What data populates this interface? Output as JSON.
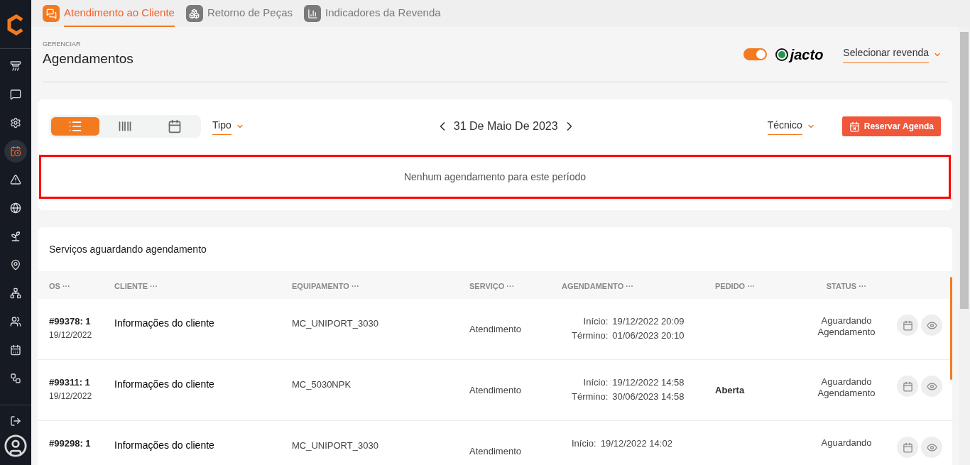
{
  "top_tabs": [
    {
      "label": "Atendimento ao Cliente",
      "selected": true
    },
    {
      "label": "Retorno de Peças",
      "selected": false
    },
    {
      "label": "Indicadores da Revenda",
      "selected": false
    }
  ],
  "sidebar": {
    "items": [
      {
        "selected": false
      },
      {
        "selected": false
      },
      {
        "selected": false
      },
      {
        "selected": true
      },
      {
        "selected": false
      },
      {
        "selected": false
      },
      {
        "selected": false
      },
      {
        "selected": false
      },
      {
        "selected": false
      },
      {
        "selected": false
      },
      {
        "selected": false
      },
      {
        "selected": false
      }
    ]
  },
  "header": {
    "overline": "GERENCIAR",
    "title": "Agendamentos",
    "toggle_on": true,
    "brand": "jacto",
    "dealer_select": "Selecionar revenda"
  },
  "toolbar": {
    "views": [
      {
        "selected": true
      },
      {
        "selected": false
      },
      {
        "selected": false
      }
    ],
    "type_select": "Tipo",
    "date": "31 De Maio De 2023",
    "tech_select": "Técnico",
    "reserve_button": "Reservar Agenda"
  },
  "empty_message": "Nenhum agendamento para este período",
  "pending": {
    "title": "Serviços aguardando agendamento",
    "columns": [
      "OS ···",
      "CLIENTE ···",
      "EQUIPAMENTO ···",
      "SERVIÇO ···",
      "AGENDAMENTO ···",
      "PEDIDO ···",
      "STATUS ···"
    ],
    "rows": [
      {
        "os": "#99378: 1",
        "date": "19/12/2022",
        "client": "Informações do cliente",
        "equipment": "MC_UNIPORT_3030",
        "service": "Atendimento",
        "start_label": "Início:",
        "start": "19/12/2022 20:09",
        "end_label": "Término:",
        "end": "01/06/2023 20:10",
        "status": "Aguardando Agendamento"
      },
      {
        "os": "#99311: 1",
        "date": "19/12/2022",
        "client": "Informações do cliente",
        "equipment": "MC_5030NPK",
        "service": "Atendimento",
        "start_label": "Início:",
        "start": "19/12/2022 14:58",
        "end_label": "Término:",
        "end": "30/06/2023 14:58",
        "order": "Aberta",
        "status": "Aguardando Agendamento"
      },
      {
        "os": "#99298: 1",
        "client": "Informações do cliente",
        "equipment": "MC_UNIPORT_3030",
        "service": "Atendimento",
        "start_label": "Início:",
        "start": "19/12/2022 14:02",
        "status": "Aguardando"
      }
    ]
  }
}
